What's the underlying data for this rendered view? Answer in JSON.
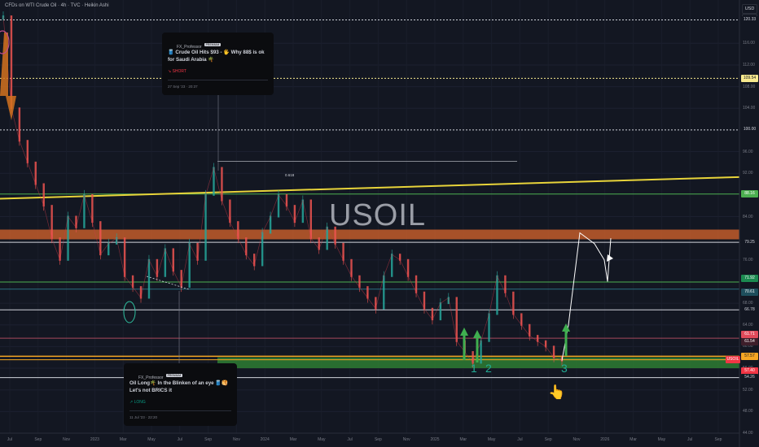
{
  "header": {
    "title": "CFDs on WTI Crude Oil · 4h · TVC · Heikin Ashi"
  },
  "currency": {
    "unit": "USD",
    "sub": "BLL"
  },
  "watermark": "USOIL",
  "fib_label": "0.618",
  "wave_labels": [
    "1",
    "2",
    "3"
  ],
  "hand_icon": "👆",
  "ideas": [
    {
      "author": "FX_Professor",
      "badge": "PREMIUM",
      "title": "🛢️ Crude Oil Hits $93 - 🖐️ Why 88$ is ok for Saudi Arabia 🌴",
      "direction": "↘ SHORT",
      "date": "27 Sep '23 · 20:37",
      "direction_color": "#f23645"
    },
    {
      "author": "FX_Professor",
      "badge": "PREMIUM",
      "title": "Oil Long🌴 In the Blinken of an eye 🛢️🥞Let's not BRICS it",
      "direction": "↗ LONG",
      "date": "11 Jul '23 · 22:20",
      "direction_color": "#089981"
    }
  ],
  "price_tags": [
    {
      "value": "120.33",
      "bg": "#131722",
      "fg": "#d1d4dc"
    },
    {
      "value": "109.54",
      "bg": "#f7e98e",
      "fg": "#131722"
    },
    {
      "value": "100.00",
      "bg": "#131722",
      "fg": "#d1d4dc"
    },
    {
      "value": "88.16",
      "bg": "#4caf50",
      "fg": "#ffffff"
    },
    {
      "value": "79.25",
      "bg": "#131722",
      "fg": "#d1d4dc"
    },
    {
      "value": "71.92",
      "bg": "#1b8a50",
      "fg": "#ffffff"
    },
    {
      "value": "70.61",
      "bg": "#1e4e5c",
      "fg": "#ffffff"
    },
    {
      "value": "66.78",
      "bg": "#131722",
      "fg": "#d1d4dc"
    },
    {
      "value": "61.71",
      "bg": "#e04a5a",
      "fg": "#ffffff"
    },
    {
      "value": "61.54",
      "bg": "#3d1e2a",
      "fg": "#ffffff"
    },
    {
      "value": "57.57",
      "bg": "#f5a623",
      "fg": "#131722"
    },
    {
      "value": "USOIL",
      "bg": "#f23645",
      "fg": "#ffffff"
    },
    {
      "value": "57.40",
      "bg": "#f23645",
      "fg": "#ffffff"
    },
    {
      "value": "54.26",
      "bg": "#131722",
      "fg": "#d1d4dc"
    }
  ],
  "chart_data": {
    "type": "line",
    "style": "Heikin Ashi candlestick",
    "title": "CFDs on WTI Crude Oil · 4h · TVC · Heikin Ashi",
    "ylim": [
      44,
      124
    ],
    "y_ticks": [
      "116.00",
      "112.00",
      "108.00",
      "104.00",
      "96.00",
      "92.00",
      "84.00",
      "76.00",
      "68.00",
      "64.00",
      "60.00",
      "56.00",
      "52.00",
      "48.00",
      "44.00"
    ],
    "x_ticks": [
      "Jul",
      "Sep",
      "Nov",
      "2023",
      "Mar",
      "May",
      "Jul",
      "Sep",
      "Nov",
      "2024",
      "Mar",
      "May",
      "Jul",
      "Sep",
      "Nov",
      "2025",
      "Mar",
      "May",
      "Jul",
      "Sep",
      "Nov",
      "2026",
      "Mar",
      "May",
      "Jul",
      "Sep"
    ],
    "series": [
      {
        "values": [
          121,
          104,
          98,
          94,
          90,
          86,
          80,
          76,
          84,
          82,
          88,
          83,
          77,
          79,
          80,
          73,
          71,
          69,
          76,
          73,
          78,
          74,
          71,
          79,
          76,
          88,
          93,
          87,
          83,
          80,
          77,
          75,
          81,
          84,
          88,
          86,
          83,
          87,
          80,
          78,
          82,
          79,
          76,
          73,
          71,
          69,
          67,
          73,
          77,
          76,
          73,
          70,
          67,
          65,
          68,
          69,
          61,
          59,
          57,
          61,
          66,
          73,
          70,
          66,
          64,
          62,
          61,
          60,
          58,
          57.4
        ]
      },
      {
        "name": "projection",
        "values": [
          57.4,
          64,
          81,
          79,
          76,
          72,
          80
        ]
      }
    ],
    "levels": [
      {
        "value": 120.33,
        "color": "#d1d4dc",
        "style": "dotted"
      },
      {
        "value": 109.54,
        "color": "#f7e98e",
        "style": "dotted"
      },
      {
        "value": 100.0,
        "color": "#d1d4dc",
        "style": "dotted"
      },
      {
        "value": 88.16,
        "color": "#4caf50",
        "style": "solid"
      },
      {
        "value": 79.25,
        "color": "#d1d4dc",
        "style": "solid"
      },
      {
        "value": 71.92,
        "color": "#4caf50",
        "style": "solid"
      },
      {
        "value": 70.61,
        "color": "#2a6f80",
        "style": "solid"
      },
      {
        "value": 66.78,
        "color": "#d1d4dc",
        "style": "solid"
      },
      {
        "value": 61.54,
        "color": "#a6485c",
        "style": "solid"
      },
      {
        "value": 57.57,
        "color": "#f5a623",
        "style": "solid"
      },
      {
        "value": 54.26,
        "color": "#d1d4dc",
        "style": "solid"
      }
    ],
    "zones": [
      {
        "from": 79.8,
        "to": 81.6,
        "color": "#b8582a"
      },
      {
        "from": 56.0,
        "to": 58.0,
        "color": "#2e7d32"
      }
    ],
    "fib": {
      "label": "0.618",
      "value": 94.2
    }
  }
}
